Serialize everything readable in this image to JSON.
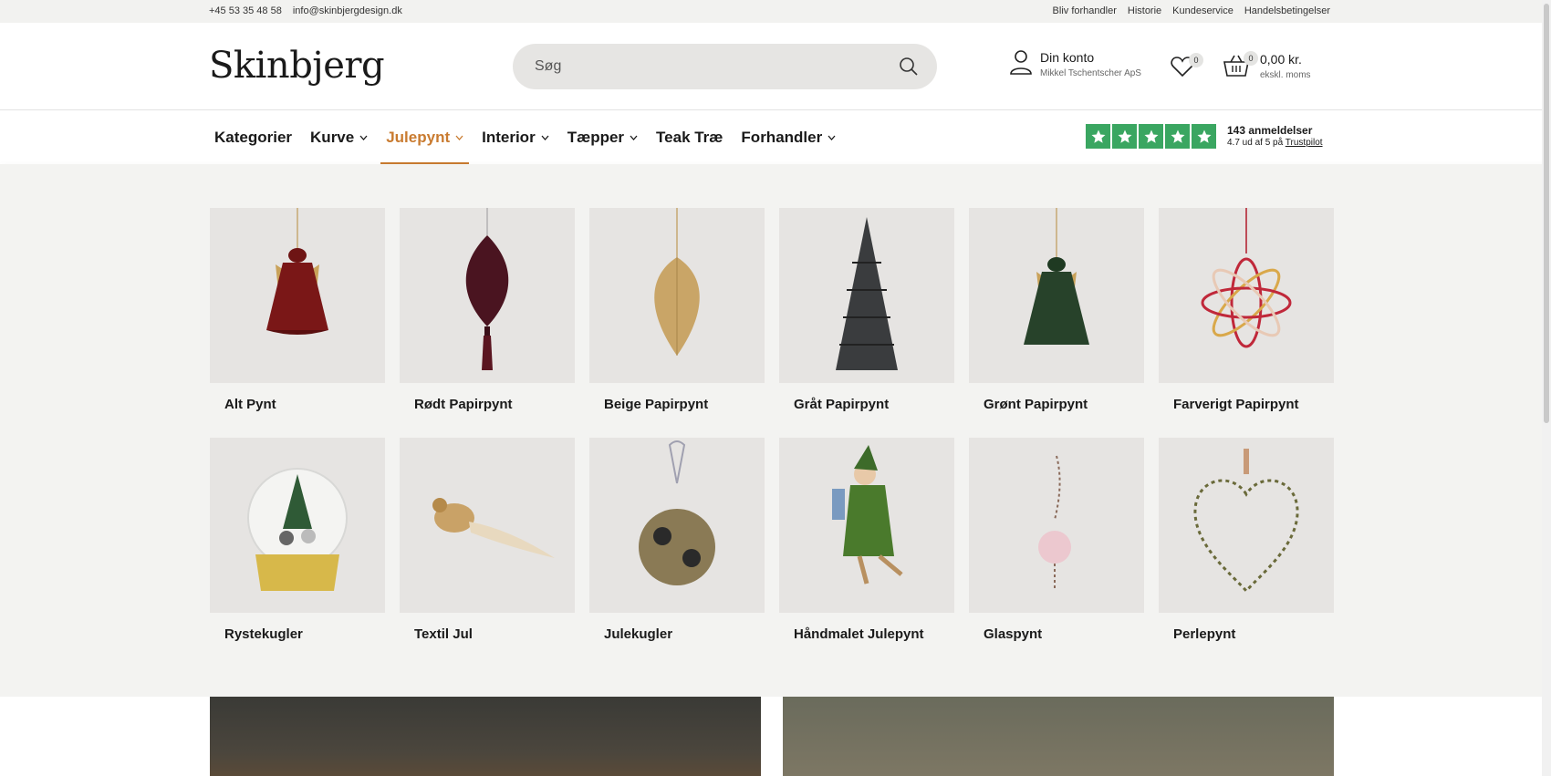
{
  "topbar": {
    "phone": "+45 53 35 48 58",
    "email": "info@skinbjergdesign.dk",
    "links": [
      "Bliv forhandler",
      "Historie",
      "Kundeservice",
      "Handelsbetingelser"
    ]
  },
  "header": {
    "logo": "Skinbjerg",
    "search_placeholder": "Søg",
    "account_title": "Din konto",
    "account_name": "Mikkel Tschentscher ApS",
    "wishlist_count": "0",
    "cart_count": "0",
    "cart_total": "0,00 kr.",
    "cart_note": "ekskl. moms"
  },
  "nav": {
    "items": [
      {
        "label": "Kategorier",
        "dropdown": false
      },
      {
        "label": "Kurve",
        "dropdown": true
      },
      {
        "label": "Julepynt",
        "dropdown": true,
        "active": true
      },
      {
        "label": "Interior",
        "dropdown": true
      },
      {
        "label": "Tæpper",
        "dropdown": true
      },
      {
        "label": "Teak Træ",
        "dropdown": false
      },
      {
        "label": "Forhandler",
        "dropdown": true
      }
    ],
    "trustpilot": {
      "reviews": "143 anmeldelser",
      "rating_prefix": "4.7 ud af 5 på",
      "brand": "Trustpilot",
      "color": "#3aa661"
    }
  },
  "mega": {
    "tiles": [
      {
        "label": "Alt Pynt",
        "icon": "red-angel-ornament"
      },
      {
        "label": "Rødt Papirpynt",
        "icon": "red-paper-drop-ornament"
      },
      {
        "label": "Beige Papirpynt",
        "icon": "beige-paper-drop-ornament"
      },
      {
        "label": "Gråt Papirpynt",
        "icon": "grey-paper-tree"
      },
      {
        "label": "Grønt Papirpynt",
        "icon": "green-angel-ornament"
      },
      {
        "label": "Farverigt Papirpynt",
        "icon": "colorful-paper-flower"
      },
      {
        "label": "Rystekugler",
        "icon": "snow-globe"
      },
      {
        "label": "Textil Jul",
        "icon": "feather-bird"
      },
      {
        "label": "Julekugler",
        "icon": "beaded-bauble"
      },
      {
        "label": "Håndmalet Julepynt",
        "icon": "painted-elf-figure"
      },
      {
        "label": "Glaspynt",
        "icon": "glass-drop-ornament"
      },
      {
        "label": "Perlepynt",
        "icon": "bead-heart"
      }
    ]
  },
  "accent_color": "#c97b30"
}
